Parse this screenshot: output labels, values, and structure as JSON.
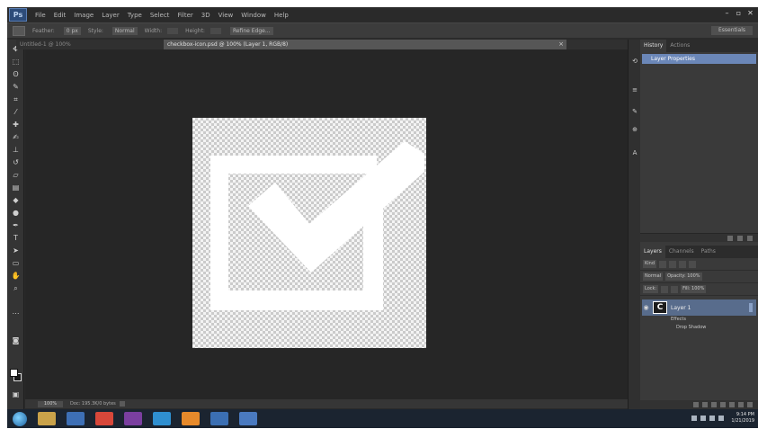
{
  "app": {
    "logo": "Ps",
    "menu": [
      "File",
      "Edit",
      "Image",
      "Layer",
      "Type",
      "Select",
      "Filter",
      "3D",
      "View",
      "Window",
      "Help"
    ],
    "window_controls": [
      "–",
      "▫",
      "✕"
    ]
  },
  "options_bar": {
    "tool_label": "Feather:",
    "feather_value": "0 px",
    "style_label": "Style:",
    "style_value": "Normal",
    "width_label": "Width:",
    "height_label": "Height:",
    "refine_button": "Refine Edge...",
    "workspace": "Essentials"
  },
  "document": {
    "tab_prefix": "Untitled-1 @ 100%",
    "tab_title": "checkbox-icon.psd @ 100% (Layer 1, RGB/8)",
    "close": "×"
  },
  "status_bar": {
    "zoom": "100%",
    "doc_info": "Doc: 195.3K/0 bytes"
  },
  "panels": {
    "history_tabs": [
      "History",
      "Actions"
    ],
    "history_items": [
      "Layer Properties"
    ],
    "layer_tabs": [
      "Layers",
      "Channels",
      "Paths"
    ],
    "kind_label": "Kind",
    "blend_mode": "Normal",
    "opacity": "Opacity: 100%",
    "lock_label": "Lock:",
    "fill": "Fill: 100%",
    "layers": [
      {
        "name": "Layer 1",
        "thumb": "C",
        "effects_label": "Effects",
        "effect": "Drop Shadow"
      }
    ]
  },
  "taskbar": {
    "apps": [
      {
        "name": "file-explorer",
        "color": "#c9a24a"
      },
      {
        "name": "media-player",
        "color": "#3d6fb5"
      },
      {
        "name": "chrome",
        "color": "#d7473a"
      },
      {
        "name": "premiere",
        "color": "#7a3fa0"
      },
      {
        "name": "edge",
        "color": "#2f8fd0"
      },
      {
        "name": "illustrator",
        "color": "#e78a2b"
      },
      {
        "name": "photoshop",
        "color": "#3b6fb3"
      },
      {
        "name": "screen-recorder",
        "color": "#4a7ac0"
      }
    ],
    "time": "9:14 PM",
    "date": "1/21/2019"
  },
  "colors": {
    "checkmark": "#ffffff",
    "selection_blue": "#6b87b8",
    "canvas_bg": "#262626"
  }
}
